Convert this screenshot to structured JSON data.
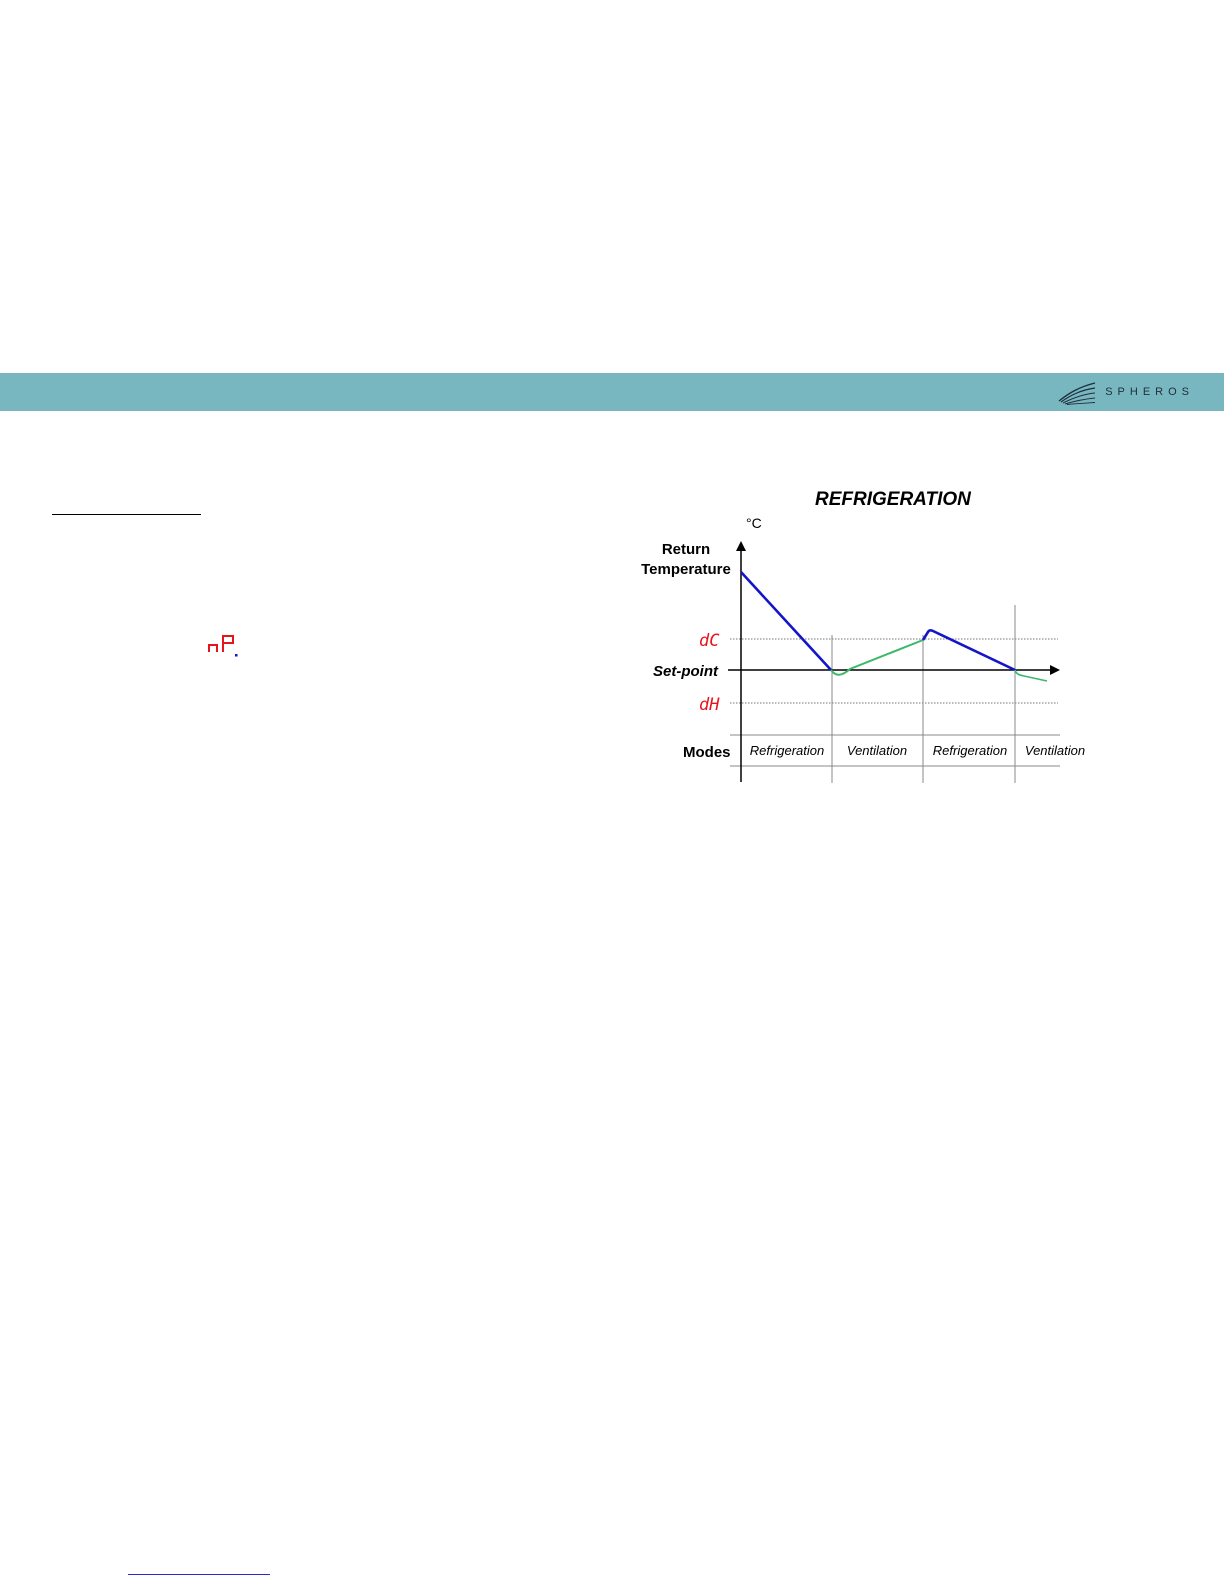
{
  "brand": {
    "name": "SPHEROS",
    "logo_icon": "spheros-swoosh-logo"
  },
  "colors": {
    "header_band": "#78b7c0",
    "cooling_line": "#1414c8",
    "ventilation_line": "#3cb86a",
    "display_code": "#e8141c"
  },
  "left_panel": {
    "display_code_icon": "seven-segment-nP-display"
  },
  "diagram": {
    "title": "REFRIGERATION",
    "unit": "°C",
    "y_label_line1": "Return",
    "y_label_line2": "Temperature",
    "level_dc": "dC",
    "level_setpoint": "Set-point",
    "level_dh": "dH",
    "modes_label": "Modes",
    "modes": [
      "Refrigeration",
      "Ventilation",
      "Refrigeration",
      "Ventilation"
    ]
  }
}
